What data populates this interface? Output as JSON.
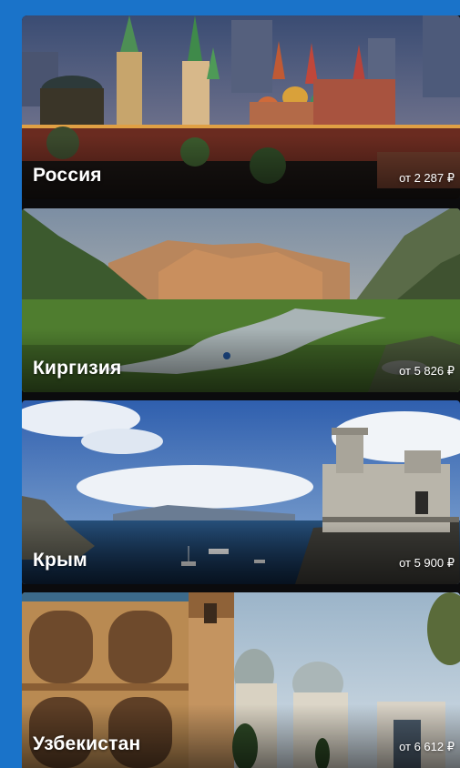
{
  "colors": {
    "background": "#1a73c9",
    "list_background": "#0b0b0d",
    "label_text": "#ffffff"
  },
  "destinations": [
    {
      "name": "Россия",
      "price": "от 2 287 ₽",
      "scene": "moscow-kremlin-night-photo"
    },
    {
      "name": "Киргизия",
      "price": "от 5 826 ₽",
      "scene": "mountain-valley-river-photo"
    },
    {
      "name": "Крым",
      "price": "от 5 900 ₽",
      "scene": "swallows-nest-castle-sea-photo"
    },
    {
      "name": "Узбекистан",
      "price": "от 6 612 ₽",
      "scene": "madrasa-domes-minaret-photo"
    }
  ]
}
